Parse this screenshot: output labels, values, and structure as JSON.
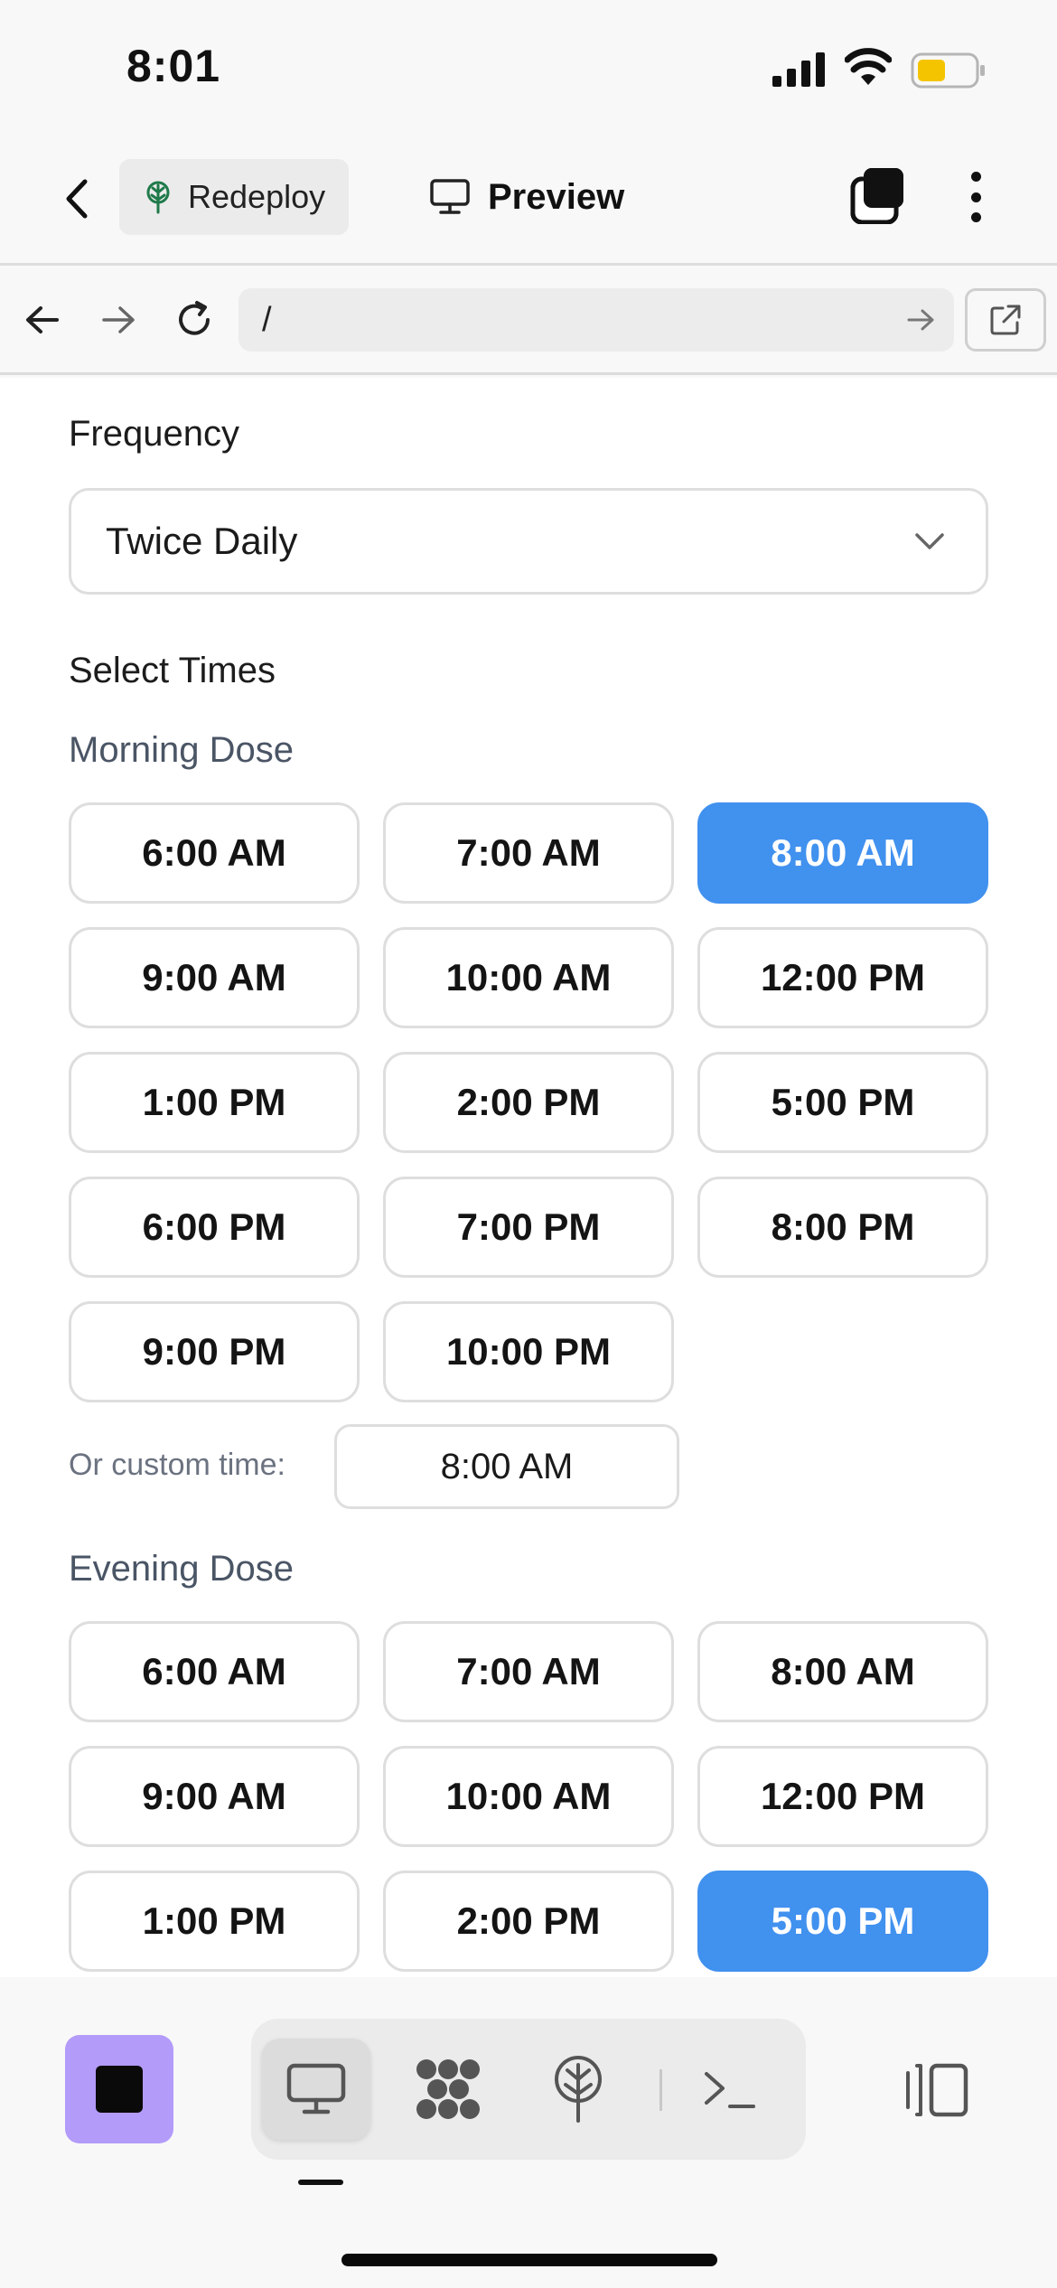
{
  "status_bar": {
    "time": "8:01"
  },
  "header": {
    "redeploy_label": "Redeploy",
    "preview_label": "Preview"
  },
  "browser": {
    "url": "/"
  },
  "form": {
    "frequency_label": "Frequency",
    "frequency_value": "Twice Daily",
    "select_times_label": "Select Times",
    "morning": {
      "label": "Morning Dose",
      "options": [
        "6:00 AM",
        "7:00 AM",
        "8:00 AM",
        "9:00 AM",
        "10:00 AM",
        "12:00 PM",
        "1:00 PM",
        "2:00 PM",
        "5:00 PM",
        "6:00 PM",
        "7:00 PM",
        "8:00 PM",
        "9:00 PM",
        "10:00 PM"
      ],
      "selected": "8:00 AM",
      "custom_label": "Or custom time:",
      "custom_value": "8:00 AM"
    },
    "evening": {
      "label": "Evening Dose",
      "options": [
        "6:00 AM",
        "7:00 AM",
        "8:00 AM",
        "9:00 AM",
        "10:00 AM",
        "12:00 PM",
        "1:00 PM",
        "2:00 PM",
        "5:00 PM"
      ],
      "selected": "5:00 PM"
    }
  },
  "colors": {
    "accent": "#4191ef",
    "stop_button": "#b39bf9",
    "battery": "#f5c400"
  },
  "toolbar": {
    "tools": [
      "desktop-icon",
      "graph-icon",
      "deploy-icon",
      "terminal-icon"
    ],
    "active_tool": "desktop-icon"
  }
}
